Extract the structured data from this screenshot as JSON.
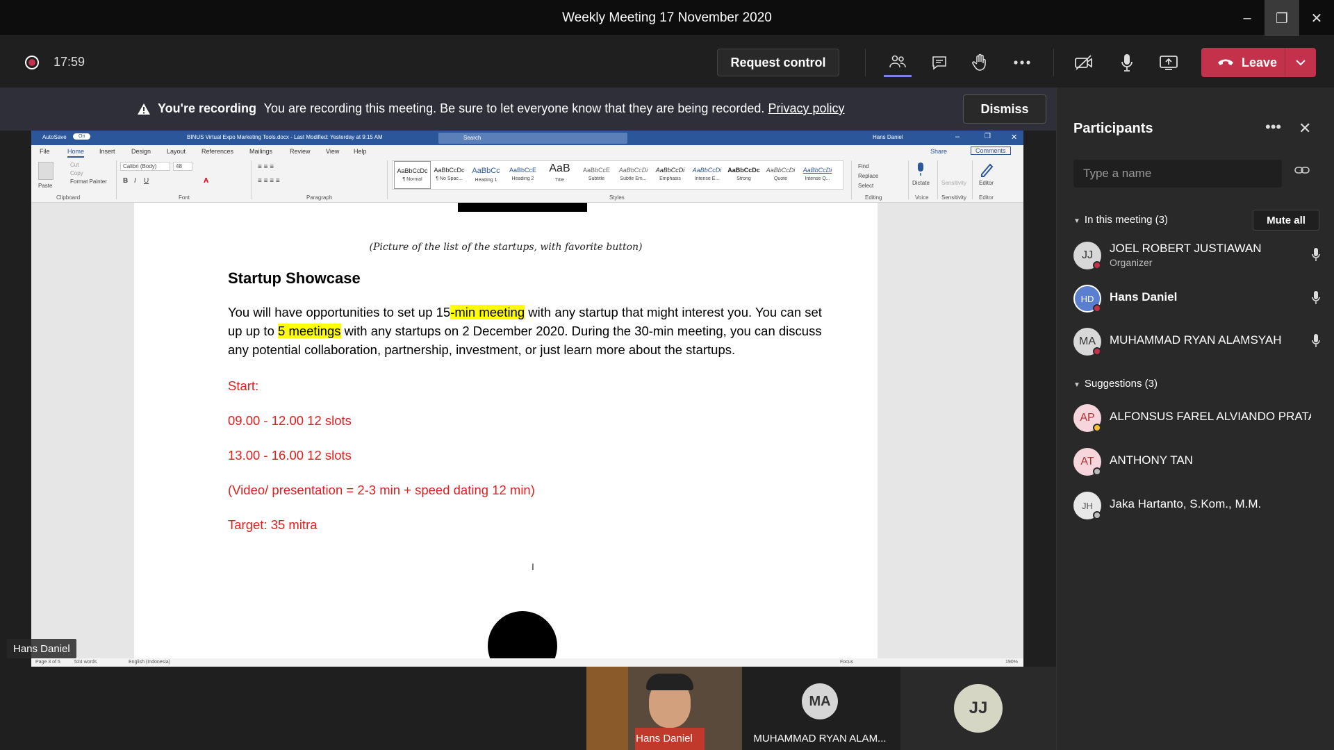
{
  "window": {
    "title": "Weekly Meeting 17 November 2020"
  },
  "toolbar": {
    "timer": "17:59",
    "request_control": "Request control",
    "leave": "Leave"
  },
  "banner": {
    "bold": "You're recording",
    "message": "You are recording this meeting. Be sure to let everyone know that they are being recorded.",
    "link": "Privacy policy",
    "dismiss": "Dismiss"
  },
  "word": {
    "autosave": "AutoSave",
    "autosave_state": "On",
    "doc_title": "BINUS Virtual Expo Marketing Tools.docx  -  Last Modified: Yesterday at 9:15 AM",
    "search": "Search",
    "user": "Hans Daniel",
    "share": "Share",
    "comments": "Comments",
    "menus": [
      "File",
      "Home",
      "Insert",
      "Design",
      "Layout",
      "References",
      "Mailings",
      "Review",
      "View",
      "Help"
    ],
    "ribbon": {
      "paste": "Paste",
      "cut": "Cut",
      "copy": "Copy",
      "format_painter": "Format Painter",
      "clipboard": "Clipboard",
      "font_name": "Calibri (Body)",
      "font_size": "48",
      "font": "Font",
      "paragraph": "Paragraph",
      "styles": "Styles",
      "find": "Find",
      "replace": "Replace",
      "select": "Select",
      "editing": "Editing",
      "dictate": "Dictate",
      "voice": "Voice",
      "sensitivity": "Sensitivity",
      "editor": "Editor"
    },
    "style_gallery": [
      {
        "preview": "AaBbCcDc",
        "name": "¶ Normal"
      },
      {
        "preview": "AaBbCcDc",
        "name": "¶ No Spac..."
      },
      {
        "preview": "AaBbCc",
        "name": "Heading 1"
      },
      {
        "preview": "AaBbCcE",
        "name": "Heading 2"
      },
      {
        "preview": "AaB",
        "name": "Title"
      },
      {
        "preview": "AaBbCcE",
        "name": "Subtitle"
      },
      {
        "preview": "AaBbCcDi",
        "name": "Subtle Em..."
      },
      {
        "preview": "AaBbCcDi",
        "name": "Emphasis"
      },
      {
        "preview": "AaBbCcDi",
        "name": "Intense E..."
      },
      {
        "preview": "AaBbCcDc",
        "name": "Strong"
      },
      {
        "preview": "AaBbCcDi",
        "name": "Quote"
      },
      {
        "preview": "AaBbCcDi",
        "name": "Intense Q..."
      }
    ],
    "document": {
      "caption": "(Picture of the list of the startups, with favorite button)",
      "heading": "Startup Showcase",
      "para_1": "You will have opportunities to set up 15",
      "para_hl1": "-min meeting",
      "para_2": " with any startup that might interest you. You can set up up to ",
      "para_hl2": "5 meetings",
      "para_3": " with any startups on 2 December 2020. During the 30-min meeting, you can discuss any potential collaboration, partnership, investment, or just learn more about the startups.",
      "start": "Start:",
      "slot1": "09.00 - 12.00 12 slots",
      "slot2": "13.00 - 16.00 12 slots",
      "format": " (Video/ presentation = 2-3 min + speed dating 12 min)",
      "target": "Target: 35 mitra"
    },
    "status": {
      "page": "Page 3 of 5",
      "words": "524 words",
      "language": "English (Indonesia)",
      "focus": "Focus",
      "zoom": "190%"
    }
  },
  "presenter_tag": "Hans Daniel",
  "strip": [
    {
      "name": "Hans Daniel",
      "initials": "",
      "video": true
    },
    {
      "name": "MUHAMMAD RYAN ALAM...",
      "initials": "MA",
      "video": false
    },
    {
      "name": "",
      "initials": "JJ",
      "video": false
    }
  ],
  "participants": {
    "title": "Participants",
    "search_placeholder": "Type a name",
    "in_meeting_label": "In this meeting (3)",
    "mute_all": "Mute all",
    "in_meeting": [
      {
        "initials": "JJ",
        "name": "JOEL ROBERT JUSTIAWAN",
        "role": "Organizer",
        "color": "#d8d8d8"
      },
      {
        "initials": "HD",
        "name": "Hans Daniel",
        "role": "",
        "color": "#5a7fd1"
      },
      {
        "initials": "MA",
        "name": "MUHAMMAD RYAN ALAMSYAH",
        "role": "",
        "color": "#d8d8d8"
      }
    ],
    "suggestions_label": "Suggestions (3)",
    "suggestions": [
      {
        "initials": "AP",
        "name": "ALFONSUS FAREL ALVIANDO PRATA...",
        "color": "#f6d6dc"
      },
      {
        "initials": "AT",
        "name": "ANTHONY TAN",
        "color": "#f6d6dc"
      },
      {
        "initials": "JH",
        "name": "Jaka Hartanto, S.Kom., M.M.",
        "color": "#e8e8e8"
      }
    ]
  },
  "colors": {
    "accent": "#7b83eb",
    "leave_red": "#c4314b",
    "word_blue": "#2b579a",
    "doc_red": "#e0201f",
    "highlight": "#ffff00"
  }
}
